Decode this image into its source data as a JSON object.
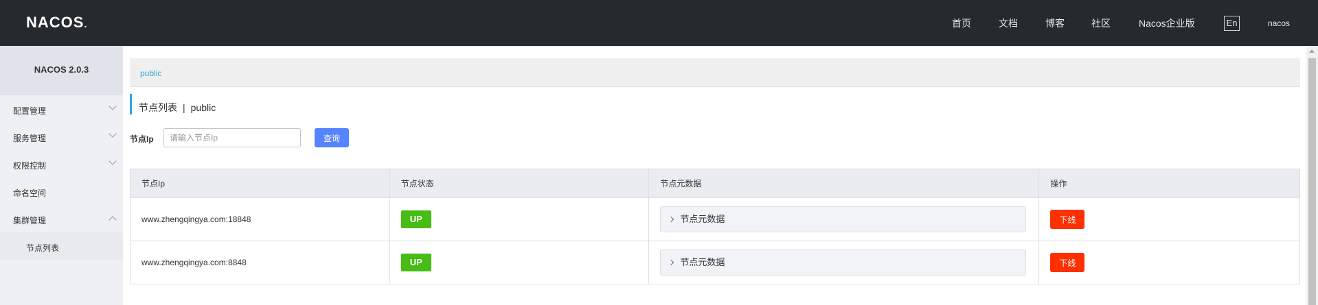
{
  "header": {
    "logo": "NACOS",
    "logo_dot": ".",
    "nav": [
      "首页",
      "文档",
      "博客",
      "社区",
      "Nacos企业版"
    ],
    "lang": "En",
    "user": "nacos"
  },
  "sidebar": {
    "version": "NACOS 2.0.3",
    "items": [
      {
        "label": "配置管理",
        "chevron": "down"
      },
      {
        "label": "服务管理",
        "chevron": "down"
      },
      {
        "label": "权限控制",
        "chevron": "down"
      },
      {
        "label": "命名空间",
        "chevron": ""
      },
      {
        "label": "集群管理",
        "chevron": "up"
      }
    ],
    "submenu": [
      "节点列表"
    ]
  },
  "main": {
    "breadcrumb": "public",
    "title": "节点列表",
    "title_sep": "|",
    "namespace": "public",
    "filter": {
      "label": "节点Ip",
      "placeholder": "请输入节点Ip",
      "value": "",
      "query_label": "查询"
    },
    "table": {
      "columns": [
        "节点Ip",
        "节点状态",
        "节点元数据",
        "操作"
      ],
      "rows": [
        {
          "ip": "www.zhengqingya.com:18848",
          "status": "UP",
          "meta": "节点元数据",
          "action": "下线"
        },
        {
          "ip": "www.zhengqingya.com:8848",
          "status": "UP",
          "meta": "节点元数据",
          "action": "下线"
        }
      ]
    }
  },
  "colors": {
    "header_bg": "#252a2f",
    "accent": "#2aa8d8",
    "primary_button": "#5584ff",
    "status_up": "#46bc15",
    "danger": "#ff3000"
  }
}
